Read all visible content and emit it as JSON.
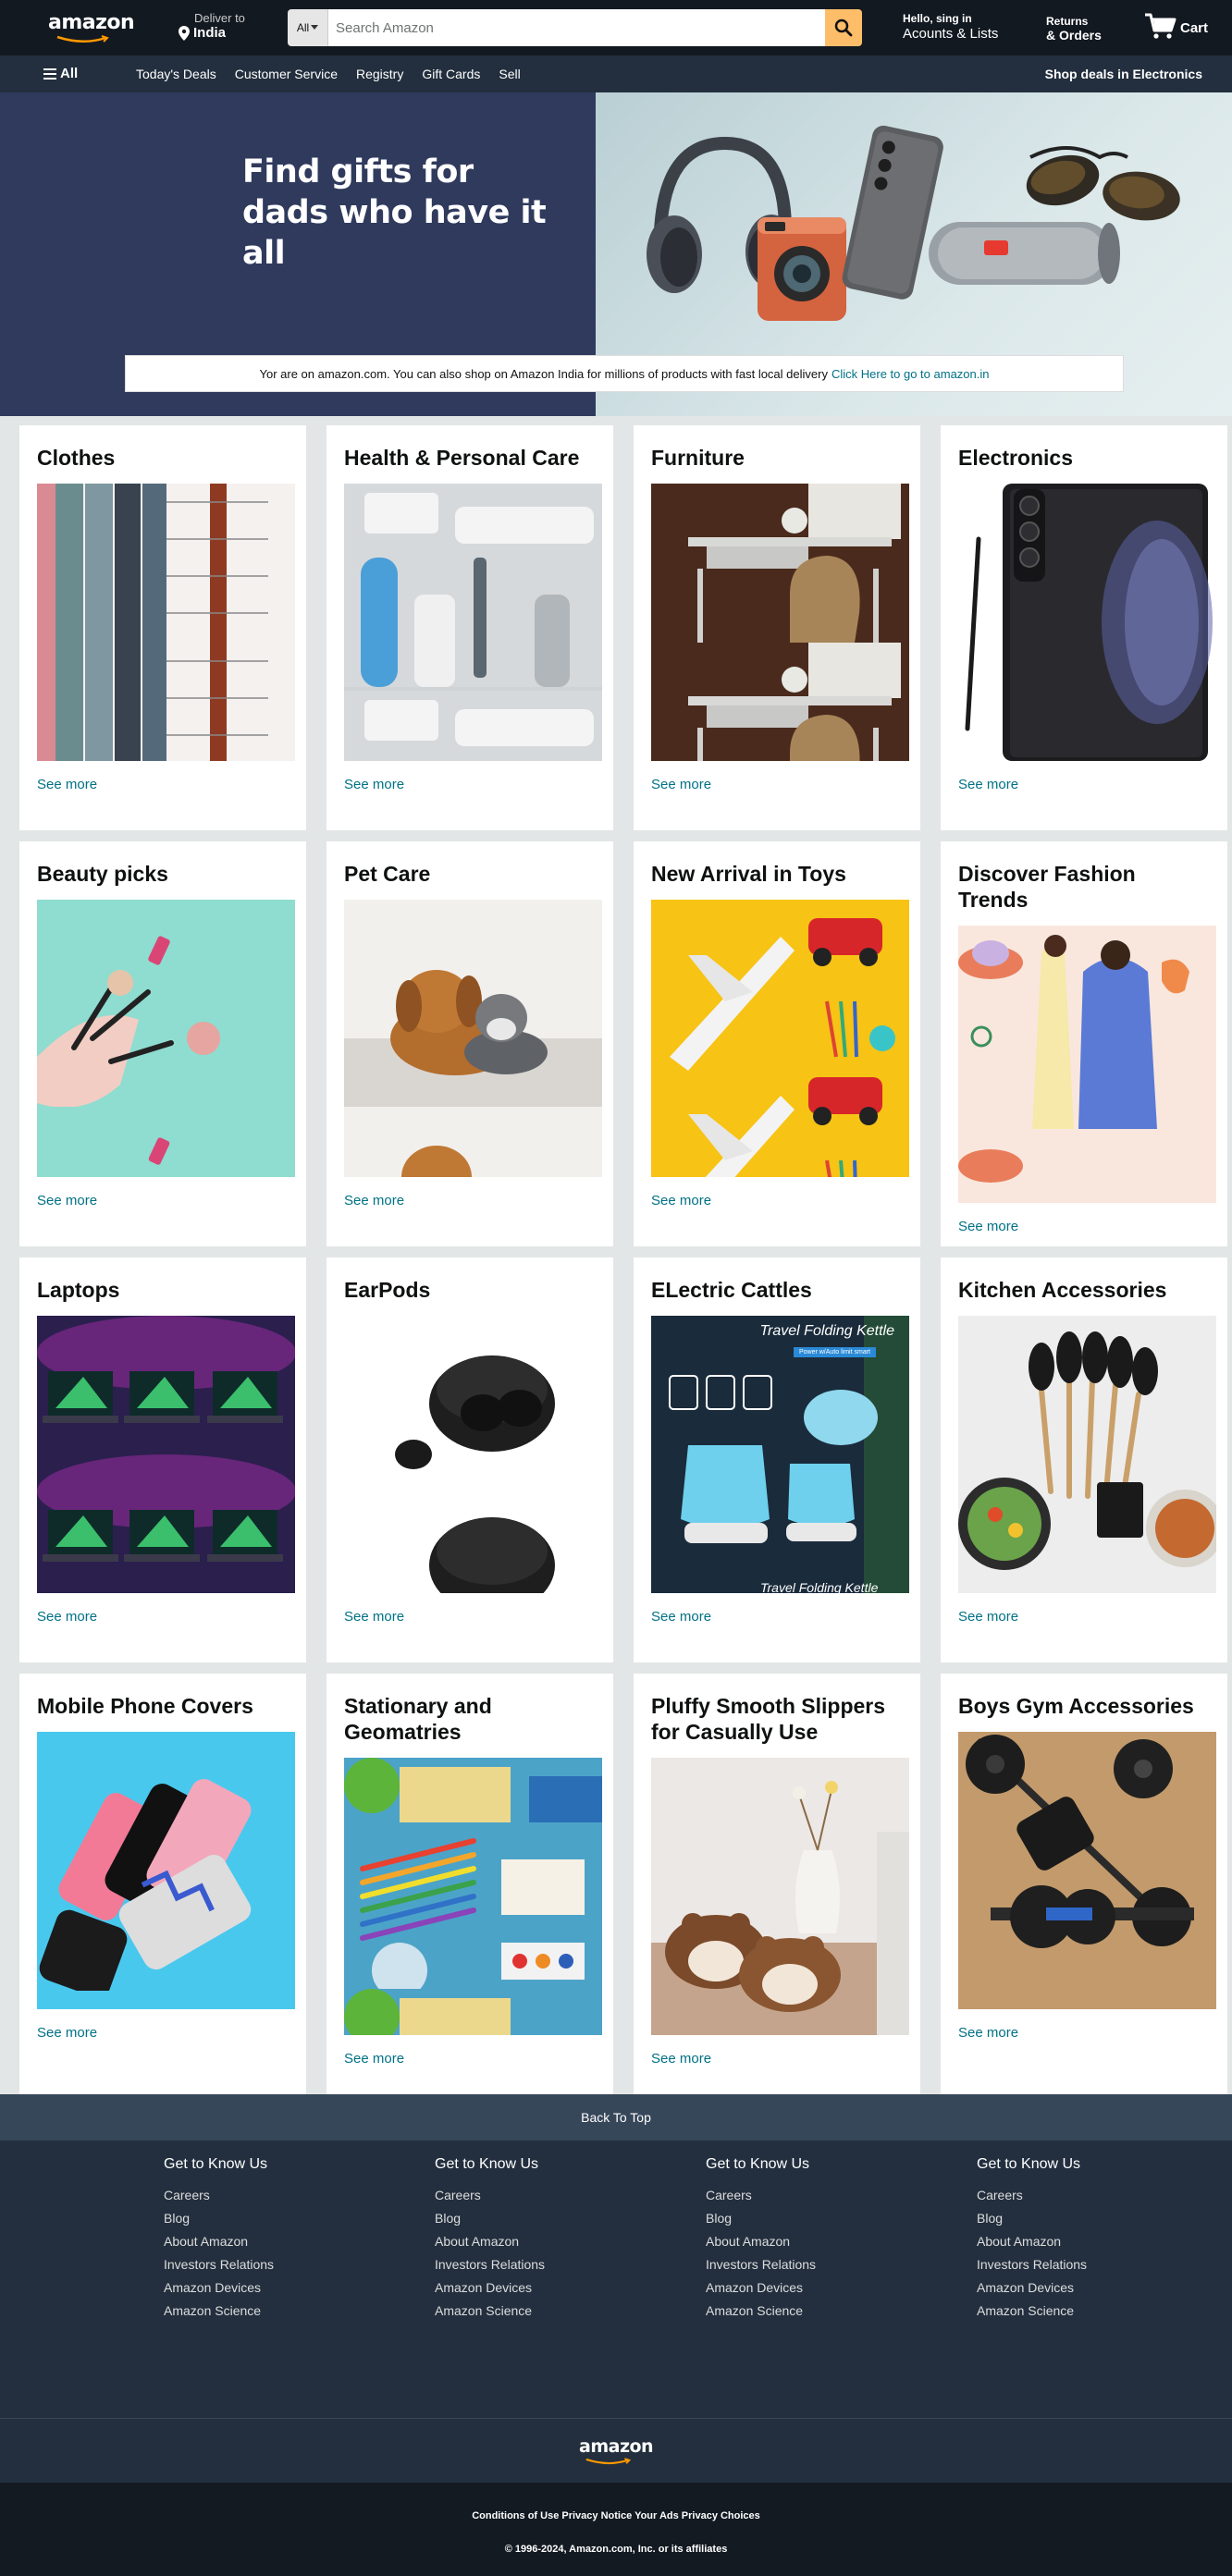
{
  "header": {
    "logo_text": "amazon",
    "deliver_label": "Deliver to",
    "deliver_location": "India",
    "search_category": "All",
    "search_placeholder": "Search Amazon",
    "account_greeting": "Hello, sing in",
    "account_label": "Acounts & Lists",
    "returns_label": "Returns",
    "orders_label": "& Orders",
    "cart_label": "Cart"
  },
  "subnav": {
    "all_label": "All",
    "links": [
      "Today's Deals",
      "Customer Service",
      "Registry",
      "Gift Cards",
      "Sell"
    ],
    "promo": "Shop deals in Electronics"
  },
  "hero": {
    "headline_line1": "Find gifts for",
    "headline_line2": "dads who have it all",
    "notice_text": "Yor are on amazon.com. You can also shop on Amazon India for millions of products with fast local delivery",
    "notice_link": "Click Here to go to amazon.in"
  },
  "cards": [
    {
      "title": "Clothes",
      "link": "See more",
      "image": "clothes"
    },
    {
      "title": "Health & Personal Care",
      "link": "See more",
      "image": "health"
    },
    {
      "title": "Furniture",
      "link": "See more",
      "image": "furniture"
    },
    {
      "title": "Electronics",
      "link": "See more",
      "image": "electronics"
    },
    {
      "title": "Beauty picks",
      "link": "See more",
      "image": "beauty"
    },
    {
      "title": "Pet Care",
      "link": "See more",
      "image": "pets"
    },
    {
      "title": "New Arrival in Toys",
      "link": "See more",
      "image": "toys"
    },
    {
      "title": "Discover Fashion Trends",
      "link": "See more",
      "image": "fashion"
    },
    {
      "title": "Laptops",
      "link": "See more",
      "image": "laptops"
    },
    {
      "title": "EarPods",
      "link": "See more",
      "image": "earpods"
    },
    {
      "title": "ELectric Cattles",
      "link": "See more",
      "image": "kettle"
    },
    {
      "title": "Kitchen Accessories",
      "link": "See more",
      "image": "kitchen"
    },
    {
      "title": "Mobile Phone Covers",
      "link": "See more",
      "image": "covers"
    },
    {
      "title": "Stationary and Geomatries",
      "link": "See more",
      "image": "stationery"
    },
    {
      "title": "Pluffy Smooth Slippers for Casually Use",
      "link": "See more",
      "image": "slippers"
    },
    {
      "title": "Boys Gym Accessories",
      "link": "See more",
      "image": "gym"
    }
  ],
  "kettle_overlay": {
    "title": "Travel Folding Kettle",
    "badge": "Power w/Auto limit smart",
    "footer_text": "Travel Folding Kettle"
  },
  "footer": {
    "back_to_top": "Back To Top",
    "columns": [
      {
        "heading": "Get to Know Us",
        "links": [
          "Careers",
          "Blog",
          "About Amazon",
          "Investors Relations",
          "Amazon Devices",
          "Amazon Science"
        ]
      },
      {
        "heading": "Get to Know Us",
        "links": [
          "Careers",
          "Blog",
          "About Amazon",
          "Investors Relations",
          "Amazon Devices",
          "Amazon Science"
        ]
      },
      {
        "heading": "Get to Know Us",
        "links": [
          "Careers",
          "Blog",
          "About Amazon",
          "Investors Relations",
          "Amazon Devices",
          "Amazon Science"
        ]
      },
      {
        "heading": "Get to Know Us",
        "links": [
          "Careers",
          "Blog",
          "About Amazon",
          "Investors Relations",
          "Amazon Devices",
          "Amazon Science"
        ]
      }
    ],
    "logo_text": "amazon",
    "legal_links": [
      "Conditions of Use",
      "Privacy Notice",
      "Your Ads Privacy Choices"
    ],
    "copyright": "© 1996-2024, Amazon.com, Inc. or its affiliates"
  },
  "colors": {
    "nav_belt": "#131921",
    "nav_main": "#232f3e",
    "search_button": "#febd69",
    "link": "#007185",
    "page_bg": "#e3e6e6",
    "back_to_top": "#37475a",
    "footer_bottom": "#131a22"
  },
  "icons": {
    "search": "magnifier-icon",
    "location": "map-pin-icon",
    "cart": "shopping-cart-icon",
    "menu": "hamburger-icon",
    "dropdown": "caret-down-icon"
  }
}
